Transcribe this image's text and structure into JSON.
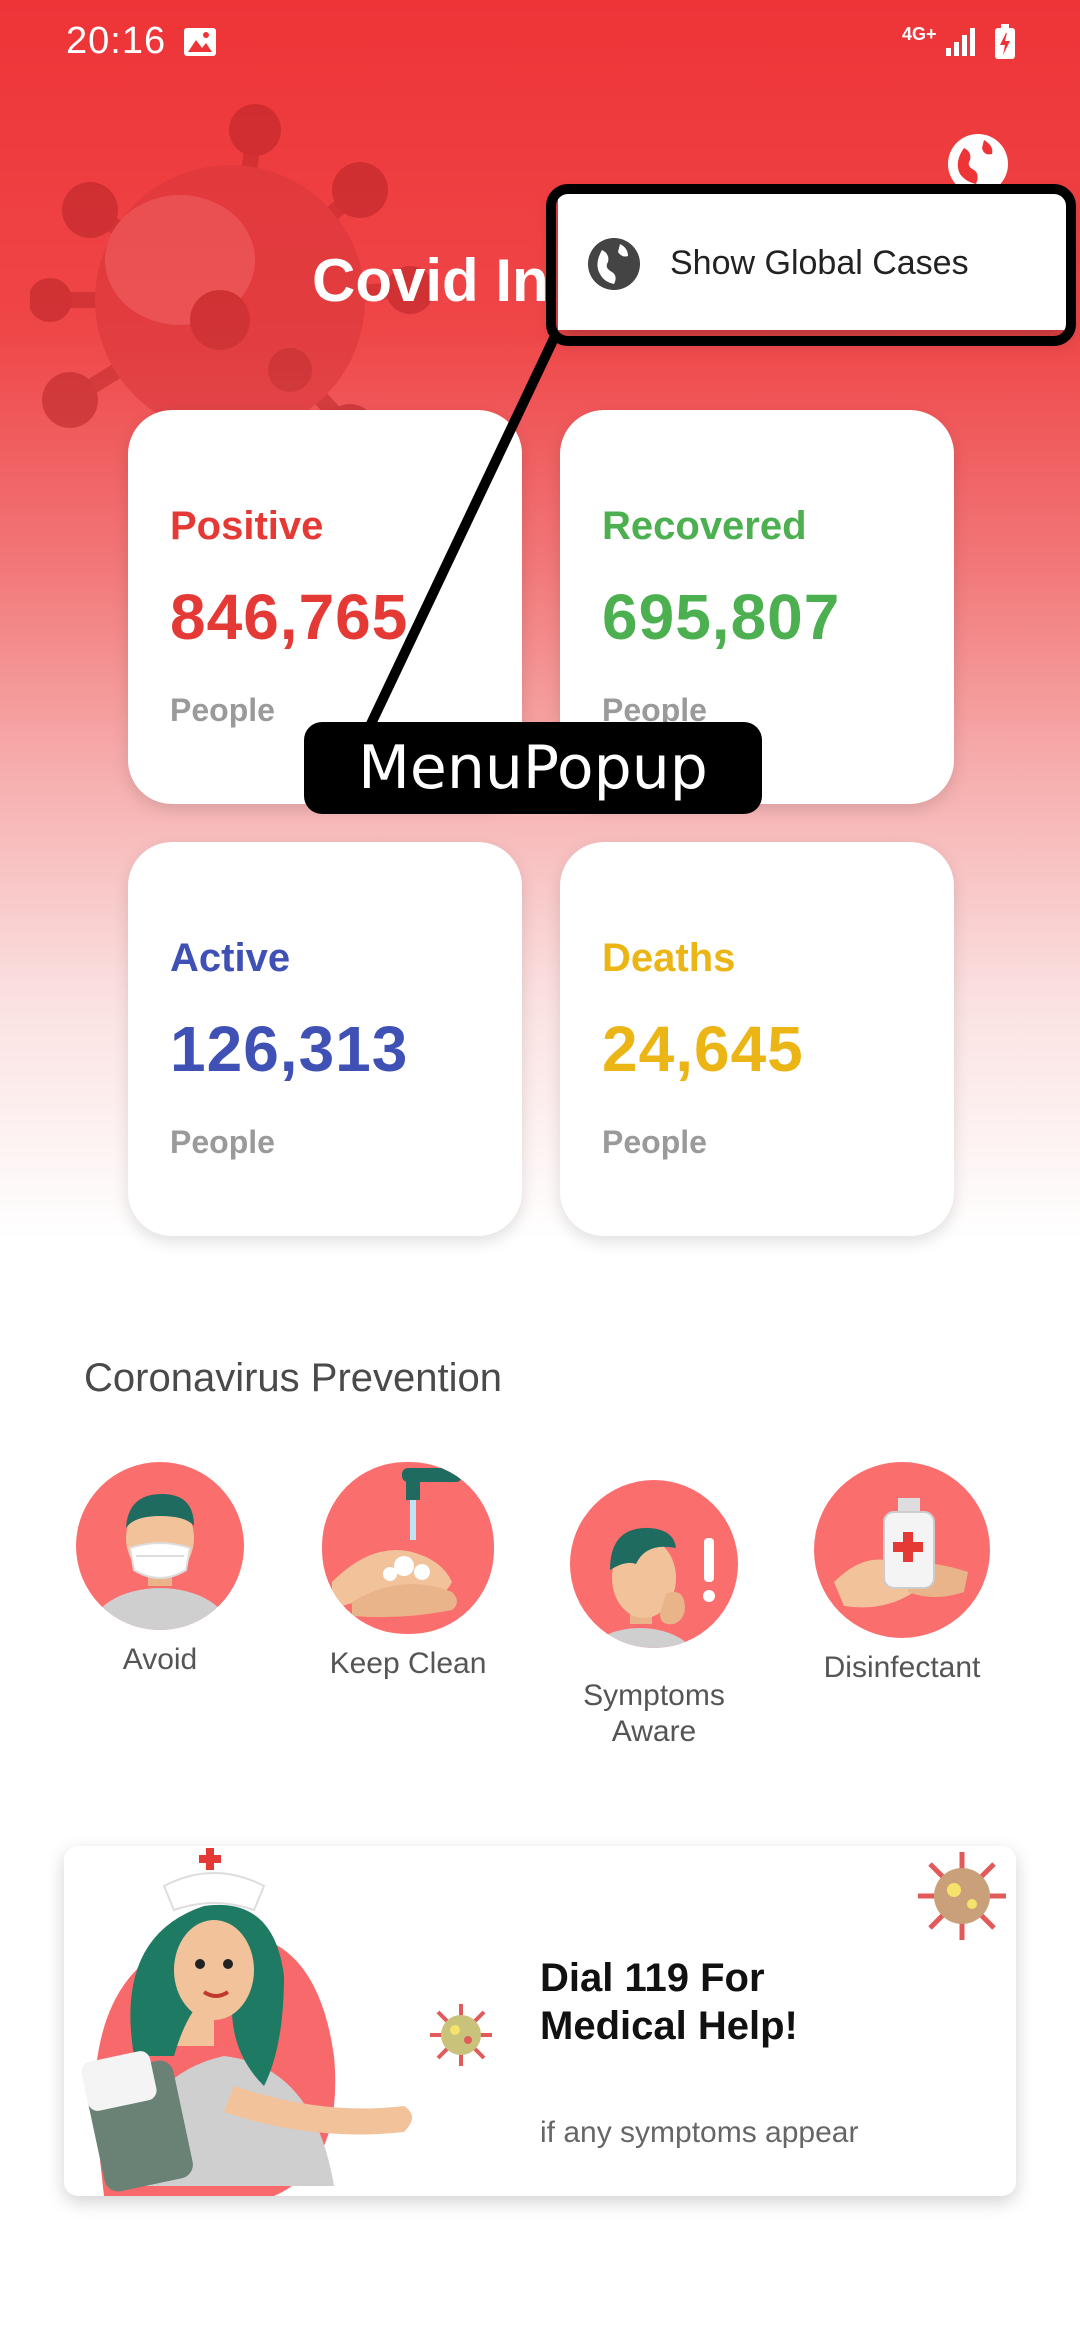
{
  "status_bar": {
    "time": "20:16",
    "network": "4G+"
  },
  "header": {
    "title": "Covid In"
  },
  "menu_popup": {
    "item_label": "Show Global Cases",
    "annotation_tag": "MenuPopup"
  },
  "stats": [
    {
      "label": "Positive",
      "value": "846,765",
      "unit": "People",
      "color": "#e53935"
    },
    {
      "label": "Recovered",
      "value": "695,807",
      "unit": "People",
      "color": "#4caf50"
    },
    {
      "label": "Active",
      "value": "126,313",
      "unit": "People",
      "color": "#3f51b5"
    },
    {
      "label": "Deaths",
      "value": "24,645",
      "unit": "People",
      "color": "#ecb516"
    }
  ],
  "prevention": {
    "title": "Coronavirus Prevention",
    "items": [
      {
        "label": "Avoid",
        "icon": "mask-person-icon"
      },
      {
        "label": "Keep Clean",
        "icon": "hand-wash-icon"
      },
      {
        "label": "Symptoms\nAware",
        "icon": "cough-person-icon"
      },
      {
        "label": "Disinfectant",
        "icon": "sanitizer-icon"
      }
    ]
  },
  "banner": {
    "title": "Dial 119 For\nMedical Help!",
    "subtitle": "if any symptoms appear"
  }
}
